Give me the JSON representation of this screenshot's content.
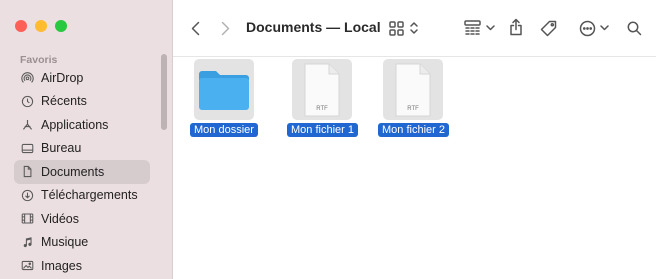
{
  "window": {
    "title": "Documents — Local"
  },
  "sidebar": {
    "section_title": "Favoris",
    "items": [
      {
        "label": "AirDrop",
        "icon": "airdrop-icon"
      },
      {
        "label": "Récents",
        "icon": "clock-icon"
      },
      {
        "label": "Applications",
        "icon": "applications-icon"
      },
      {
        "label": "Bureau",
        "icon": "desktop-icon"
      },
      {
        "label": "Documents",
        "icon": "document-icon",
        "active": true
      },
      {
        "label": "Téléchargements",
        "icon": "download-icon"
      },
      {
        "label": "Vidéos",
        "icon": "film-icon"
      },
      {
        "label": "Musique",
        "icon": "music-icon"
      },
      {
        "label": "Images",
        "icon": "photo-icon"
      }
    ]
  },
  "files": [
    {
      "name": "Mon dossier",
      "type": "folder",
      "selected": true
    },
    {
      "name": "Mon fichier 1",
      "type": "file",
      "ext": "RTF",
      "selected": true
    },
    {
      "name": "Mon fichier 2",
      "type": "file",
      "ext": "RTF",
      "selected": true
    }
  ],
  "colors": {
    "accent": "#2167d1",
    "folder": "#4bb0f0",
    "sidebar_bg": "#ecdfe1"
  }
}
